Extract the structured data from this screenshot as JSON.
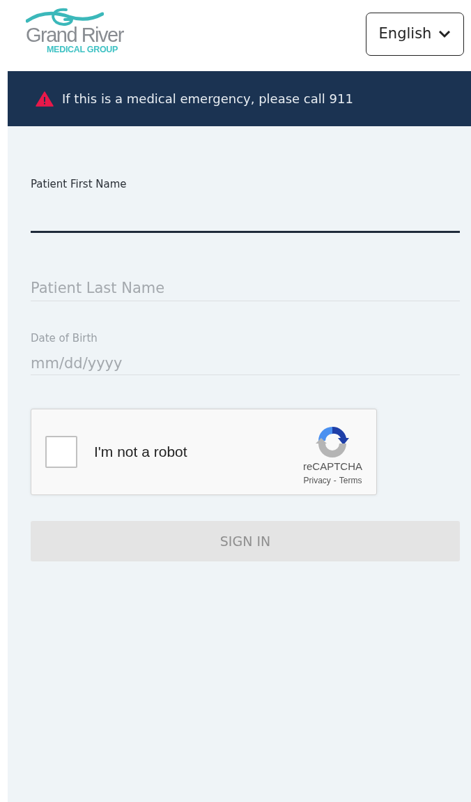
{
  "header": {
    "logo": {
      "name": "Grand River",
      "subtitle": "MEDICAL GROUP"
    },
    "language": {
      "value": "English"
    }
  },
  "alert": {
    "text": "If this is a medical emergency, please call 911"
  },
  "fields": [
    {
      "kind": "floating",
      "label": "Patient First Name",
      "focused": true
    },
    {
      "kind": "floating",
      "placeholder": "Patient Last Name",
      "focused": false
    },
    {
      "kind": "date",
      "label": "Date of Birth",
      "placeholder": "mm/dd/yyyy"
    }
  ],
  "captcha": {
    "label": "I'm not a robot",
    "checked": false,
    "brand": "reCAPTCHA",
    "privacy": "Privacy",
    "separator": "-",
    "terms": "Terms"
  },
  "submit": {
    "label": "SIGN IN",
    "disabled": true
  }
}
